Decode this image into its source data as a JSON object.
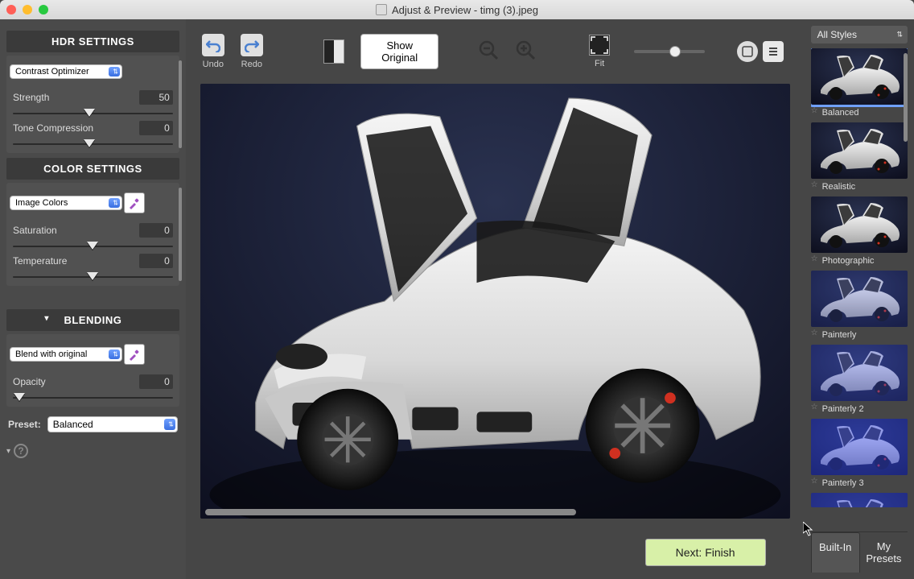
{
  "window": {
    "title": "Adjust & Preview - timg (3).jpeg"
  },
  "toolbar": {
    "undo_label": "Undo",
    "redo_label": "Redo",
    "show_original_label": "Show Original",
    "fit_label": "Fit"
  },
  "left_panel": {
    "hdr_header": "HDR SETTINGS",
    "hdr_method": "Contrast Optimizer",
    "strength_label": "Strength",
    "strength_value": "50",
    "tone_label": "Tone Compression",
    "tone_value": "0",
    "color_header": "COLOR SETTINGS",
    "color_mode": "Image Colors",
    "saturation_label": "Saturation",
    "saturation_value": "0",
    "temperature_label": "Temperature",
    "temperature_value": "0",
    "blending_header": "BLENDING",
    "blend_mode": "Blend with original",
    "opacity_label": "Opacity",
    "opacity_value": "0",
    "preset_label": "Preset:",
    "preset_value": "Balanced"
  },
  "right_panel": {
    "filter": "All Styles",
    "presets": [
      {
        "name": "Balanced",
        "selected": true,
        "overlay": "none"
      },
      {
        "name": "Realistic",
        "selected": false,
        "overlay": "none"
      },
      {
        "name": "Photographic",
        "selected": false,
        "overlay": "none"
      },
      {
        "name": "Painterly",
        "selected": false,
        "overlay": "blue1"
      },
      {
        "name": "Painterly 2",
        "selected": false,
        "overlay": "blue2"
      },
      {
        "name": "Painterly 3",
        "selected": false,
        "overlay": "blue3"
      }
    ],
    "tab_builtin": "Built-In",
    "tab_mypresets": "My Presets"
  },
  "footer": {
    "next_label": "Next: Finish"
  }
}
